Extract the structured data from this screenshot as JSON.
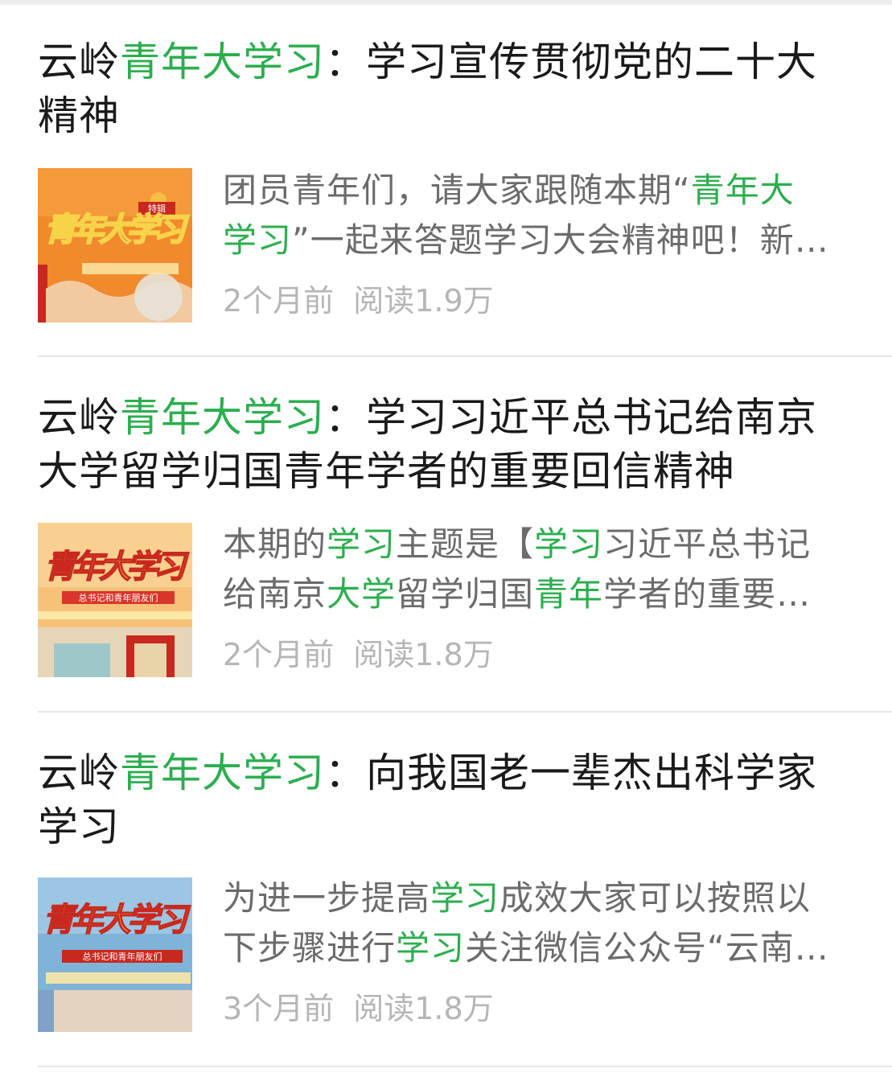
{
  "articles": [
    {
      "title_parts": [
        {
          "text": "云岭",
          "hl": false
        },
        {
          "text": "青年大学习",
          "hl": true
        },
        {
          "text": "：学习宣传贯彻党的二十大精神",
          "hl": false
        }
      ],
      "summary_line1": [
        {
          "text": "团员青年们，请大家跟随本期“",
          "hl": false
        },
        {
          "text": "青年大",
          "hl": true
        }
      ],
      "summary_line2": [
        {
          "text": "学习",
          "hl": true
        },
        {
          "text": "”一起来答题学习大会精神吧！新…",
          "hl": false
        }
      ],
      "time": "2个月前",
      "reads": "阅读1.9万",
      "thumb_text": "青年大学习",
      "thumb_badge": "特辑"
    },
    {
      "title_parts": [
        {
          "text": "云岭",
          "hl": false
        },
        {
          "text": "青年大学习",
          "hl": true
        },
        {
          "text": "：学习习近平总书记给南京大学留学归国青年学者的重要回信精神",
          "hl": false
        }
      ],
      "summary_line1": [
        {
          "text": "本期的",
          "hl": false
        },
        {
          "text": "学习",
          "hl": true
        },
        {
          "text": "主题是【",
          "hl": false
        },
        {
          "text": "学习",
          "hl": true
        },
        {
          "text": "习近平总书记",
          "hl": false
        }
      ],
      "summary_line2": [
        {
          "text": "给南京",
          "hl": false
        },
        {
          "text": "大学",
          "hl": true
        },
        {
          "text": "留学归国",
          "hl": false
        },
        {
          "text": "青年",
          "hl": true
        },
        {
          "text": "学者的重要…",
          "hl": false
        }
      ],
      "time": "2个月前",
      "reads": "阅读1.8万",
      "thumb_text": "青年大学习",
      "thumb_badge": "总书记和青年朋友们"
    },
    {
      "title_parts": [
        {
          "text": "云岭",
          "hl": false
        },
        {
          "text": "青年大学习",
          "hl": true
        },
        {
          "text": "：向我国老一辈杰出科学家学习",
          "hl": false
        }
      ],
      "summary_line1": [
        {
          "text": "为进一步提高",
          "hl": false
        },
        {
          "text": "学习",
          "hl": true
        },
        {
          "text": "成效大家可以按照以",
          "hl": false
        }
      ],
      "summary_line2": [
        {
          "text": "下步骤进行",
          "hl": false
        },
        {
          "text": "学习",
          "hl": true
        },
        {
          "text": "关注微信公众号“云南…",
          "hl": false
        }
      ],
      "time": "3个月前",
      "reads": "阅读1.8万",
      "thumb_text": "青年大学习",
      "thumb_badge": "总书记和青年朋友们"
    }
  ],
  "colors": {
    "highlight": "#2bae4e",
    "title": "#1a1a1a",
    "summary": "#6b6b6b",
    "meta": "#b5b5b5"
  }
}
